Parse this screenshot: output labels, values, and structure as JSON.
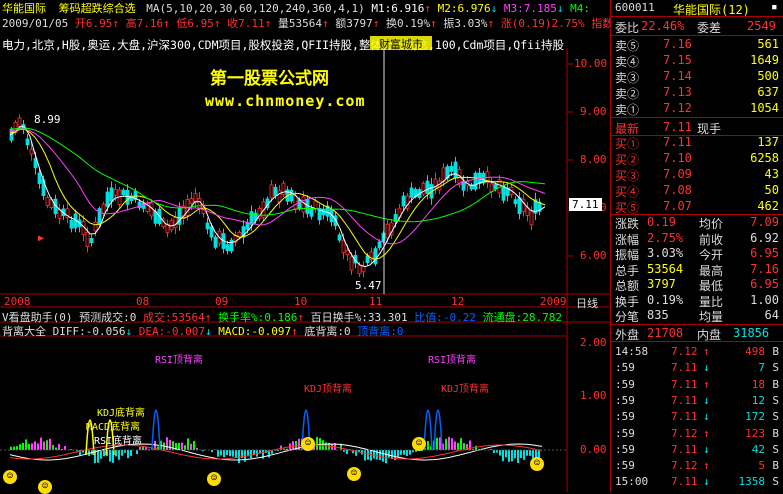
{
  "colors": {
    "up": "#ff3030",
    "down": "#00e0e0",
    "flat": "#ffffff",
    "accent": "#ffff00",
    "grid": "#a00000",
    "ma1": "#ffffff",
    "ma2": "#ffff00",
    "ma3": "#ff40ff",
    "ma4": "#00ff00"
  },
  "header": {
    "stock_name": "华能国际",
    "indicator_title": "筹码超跌综合选",
    "ma_params": "MA(5,10,20,30,60,120,240,360,4,1)",
    "m1": "M1:6.916",
    "m2": "M2:6.976",
    "m3": "M3:7.185",
    "m4": "M4:",
    "date": "2009/01/05",
    "open": "开6.95",
    "high": "高7.16",
    "low": "低6.95",
    "close": "收7.11",
    "volume": "量53564",
    "amount": "额3797",
    "turnover": "换0.19%",
    "amplitude": "振3.03%",
    "change": "涨(0.19)2.75%",
    "index_label": "指数",
    "concepts": "电力,北京,H股,奥运,大盘,沪深300,CDM项目,股权投资,QFII持股,整体上市概念,",
    "concepts_tail": "100,Cdm项目,Qfii持股",
    "overlay_box": "财富城市"
  },
  "watermark": {
    "line1": "第一股票公式网",
    "line2": "www.chnmoney.com"
  },
  "price_axis": {
    "labels": [
      "10.00",
      "9.00",
      "8.00",
      "7.00",
      "6.00"
    ],
    "current": "7.11"
  },
  "annotations": {
    "high_label": "8.99",
    "low_label": "5.47"
  },
  "date_axis": {
    "labels": [
      "2008",
      "08",
      "09",
      "10",
      "11",
      "12",
      "2009"
    ],
    "period": "日线"
  },
  "sub1": {
    "title": "V看盘助手(0)",
    "predict": "预测成交:0",
    "volume": "成交:53564",
    "turnover_rate": "换手率%:0.186",
    "hundred_day": "百日换手%:33.301",
    "ratio": "比值:-0.22",
    "float": "流通盘:28.782"
  },
  "sub2": {
    "title": "背离大全",
    "diff": "DIFF:-0.056",
    "dea": "DEA:-0.007",
    "macd": "MACD:-0.097",
    "bottom": "底背离:0",
    "top": "顶背离:0",
    "y_labels": [
      "2.00",
      "1.00",
      "0.00"
    ],
    "labels": {
      "rsi_top": "RSI顶背离",
      "kdj_top": "KDJ顶背离",
      "kdj_bottom": "KDJ底背离",
      "macd_bottom": "MACD底背离",
      "rsi_bottom": "RSI底背离"
    }
  },
  "quote": {
    "code": "600011",
    "name": "华能国际(12)",
    "weibi_label": "委比",
    "weibi": "22.46%",
    "weicha_label": "委差",
    "weicha": "2549",
    "sells": [
      {
        "label": "卖⑤",
        "price": "7.16",
        "vol": "561"
      },
      {
        "label": "卖④",
        "price": "7.15",
        "vol": "1649"
      },
      {
        "label": "卖③",
        "price": "7.14",
        "vol": "500"
      },
      {
        "label": "卖②",
        "price": "7.13",
        "vol": "637"
      },
      {
        "label": "卖①",
        "price": "7.12",
        "vol": "1054"
      }
    ],
    "last_label": "最新",
    "last": "7.11",
    "type": "现手",
    "buys": [
      {
        "label": "买①",
        "price": "7.11",
        "vol": "137"
      },
      {
        "label": "买②",
        "price": "7.10",
        "vol": "6258"
      },
      {
        "label": "买③",
        "price": "7.09",
        "vol": "43"
      },
      {
        "label": "买④",
        "price": "7.08",
        "vol": "50"
      },
      {
        "label": "买⑤",
        "price": "7.07",
        "vol": "462"
      }
    ],
    "stats": [
      {
        "l1": "涨跌",
        "v1": "0.19",
        "l2": "均价",
        "v2": "7.09"
      },
      {
        "l1": "涨幅",
        "v1": "2.75%",
        "l2": "前收",
        "v2": "6.92"
      },
      {
        "l1": "振幅",
        "v1": "3.03%",
        "l2": "今开",
        "v2": "6.95"
      },
      {
        "l1": "总手",
        "v1": "53564",
        "l2": "最高",
        "v2": "7.16"
      },
      {
        "l1": "总额",
        "v1": "3797",
        "l2": "最低",
        "v2": "6.95"
      },
      {
        "l1": "换手",
        "v1": "0.19%",
        "l2": "量比",
        "v2": "1.00"
      },
      {
        "l1": "分笔",
        "v1": "835",
        "l2": "均量",
        "v2": "64"
      }
    ],
    "outer_label": "外盘",
    "outer": "21708",
    "inner_label": "内盘",
    "inner": "31856",
    "ticks": [
      {
        "time": "14:58",
        "price": "7.12",
        "vol": "498",
        "flag": "B"
      },
      {
        "time": ":59",
        "price": "7.11",
        "vol": "7",
        "flag": "S"
      },
      {
        "time": ":59",
        "price": "7.11",
        "vol": "18",
        "flag": "B"
      },
      {
        "time": ":59",
        "price": "7.11",
        "vol": "12",
        "flag": "S"
      },
      {
        "time": ":59",
        "price": "7.11",
        "vol": "172",
        "flag": "S"
      },
      {
        "time": ":59",
        "price": "7.12",
        "vol": "123",
        "flag": "B"
      },
      {
        "time": ":59",
        "price": "7.11",
        "vol": "42",
        "flag": "S"
      },
      {
        "time": ":59",
        "price": "7.12",
        "vol": "5",
        "flag": "B"
      },
      {
        "time": "15:00",
        "price": "7.11",
        "vol": "1358",
        "flag": "S"
      }
    ]
  }
}
